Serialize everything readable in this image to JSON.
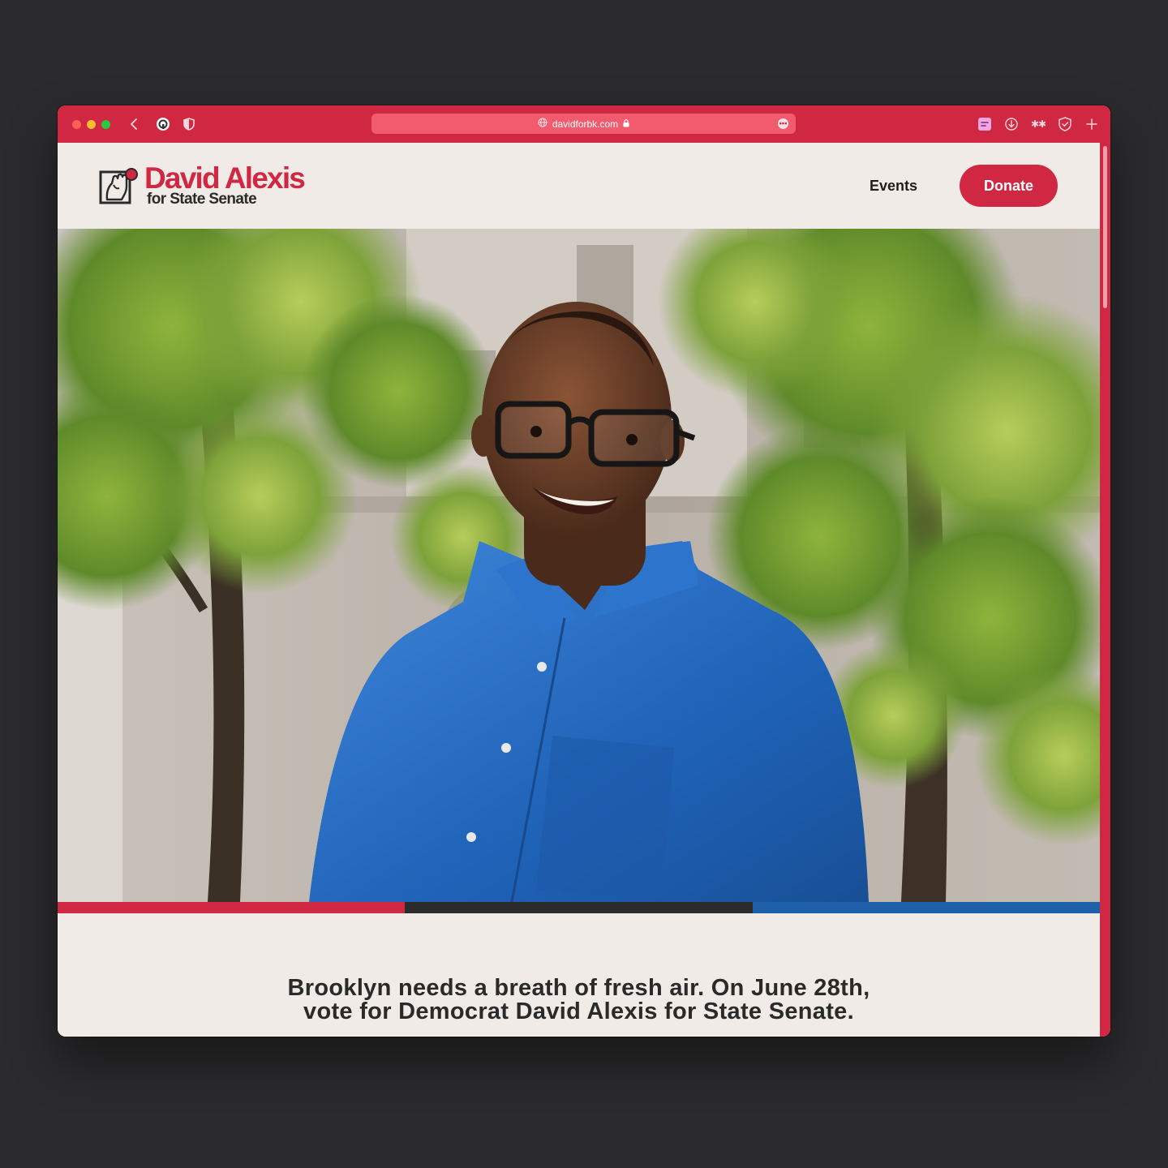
{
  "browser": {
    "url": "davidforbk.com",
    "accent_color": "#d02843",
    "url_bar_color": "#f25b6e",
    "toolbar_icons": [
      "back-chevron-icon",
      "extension-icon",
      "shield-icon",
      "extension-badge-icon",
      "download-icon",
      "passwords-icon",
      "ad-block-shield-icon",
      "new-tab-plus-icon"
    ]
  },
  "header": {
    "logo_name": "David Alexis",
    "logo_sub": "for State Senate",
    "nav_events": "Events",
    "donate_label": "Donate"
  },
  "hero": {
    "image": "portrait-photo",
    "stripe_colors": [
      "#d02843",
      "#2b2b2b",
      "#1d5fa8"
    ]
  },
  "intro": {
    "line1": "Brooklyn needs a breath of fresh air. On June 28th,",
    "line2": "vote for Democrat David Alexis for State Senate."
  },
  "colors": {
    "brand_red": "#d02843",
    "page_bg": "#f0ebe6",
    "text_dark": "#2a2a2a"
  }
}
